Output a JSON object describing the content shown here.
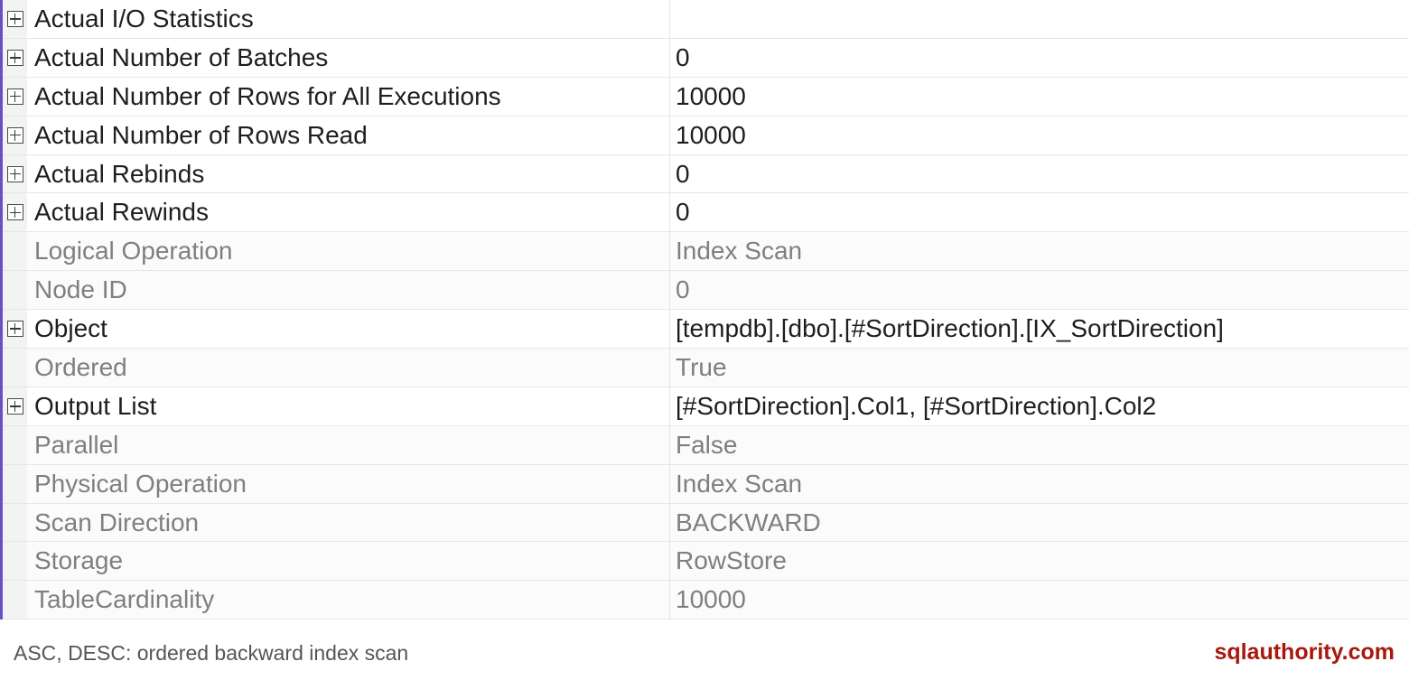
{
  "properties": [
    {
      "name": "Actual I/O Statistics",
      "value": "",
      "expandable": true,
      "muted": false
    },
    {
      "name": "Actual Number of Batches",
      "value": "0",
      "expandable": true,
      "muted": false
    },
    {
      "name": "Actual Number of Rows for All Executions",
      "value": "10000",
      "expandable": true,
      "muted": false
    },
    {
      "name": "Actual Number of Rows Read",
      "value": "10000",
      "expandable": true,
      "muted": false
    },
    {
      "name": "Actual Rebinds",
      "value": "0",
      "expandable": true,
      "muted": false
    },
    {
      "name": "Actual Rewinds",
      "value": "0",
      "expandable": true,
      "muted": false
    },
    {
      "name": "Logical Operation",
      "value": "Index Scan",
      "expandable": false,
      "muted": true
    },
    {
      "name": "Node ID",
      "value": "0",
      "expandable": false,
      "muted": true
    },
    {
      "name": "Object",
      "value": "[tempdb].[dbo].[#SortDirection].[IX_SortDirection]",
      "expandable": true,
      "muted": false
    },
    {
      "name": "Ordered",
      "value": "True",
      "expandable": false,
      "muted": true
    },
    {
      "name": "Output List",
      "value": "[#SortDirection].Col1, [#SortDirection].Col2",
      "expandable": true,
      "muted": false
    },
    {
      "name": "Parallel",
      "value": "False",
      "expandable": false,
      "muted": true
    },
    {
      "name": "Physical Operation",
      "value": "Index Scan",
      "expandable": false,
      "muted": true
    },
    {
      "name": "Scan Direction",
      "value": "BACKWARD",
      "expandable": false,
      "muted": true
    },
    {
      "name": "Storage",
      "value": "RowStore",
      "expandable": false,
      "muted": true
    },
    {
      "name": "TableCardinality",
      "value": "10000",
      "expandable": false,
      "muted": true
    }
  ],
  "footer": {
    "caption": "ASC, DESC: ordered backward index scan",
    "brand": "sqlauthority.com"
  },
  "colors": {
    "accent_border": "#6b4fc4",
    "brand": "#a8180e",
    "muted_text": "#7f7f7f",
    "text": "#1e1e1e"
  },
  "icons": {
    "expander": "plus-box-icon"
  }
}
